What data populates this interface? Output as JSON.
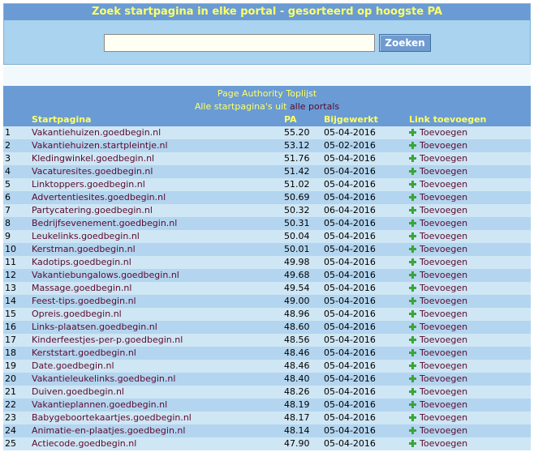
{
  "search": {
    "title": "Zoek startpagina in elke portal - gesorteerd op hoogste PA",
    "input_value": "",
    "placeholder": "",
    "button_label": "Zoeken"
  },
  "toplist": {
    "title": "Page Authority Toplijst",
    "subtitle_prefix": "Alle startpagina's uit ",
    "subtitle_link": "alle portals",
    "headers": {
      "rank": "",
      "name": "Startpagina",
      "pa": "PA",
      "date": "Bijgewerkt",
      "add": "Link toevoegen"
    },
    "rows": [
      {
        "rank": "1",
        "name": "Vakantiehuizen.goedbegin.nl",
        "pa": "55.20",
        "date": "05-04-2016",
        "add": "Toevoegen"
      },
      {
        "rank": "2",
        "name": "Vakantiehuizen.startpleintje.nl",
        "pa": "53.12",
        "date": "05-02-2016",
        "add": "Toevoegen"
      },
      {
        "rank": "3",
        "name": "Kledingwinkel.goedbegin.nl",
        "pa": "51.76",
        "date": "05-04-2016",
        "add": "Toevoegen"
      },
      {
        "rank": "4",
        "name": "Vacaturesites.goedbegin.nl",
        "pa": "51.42",
        "date": "05-04-2016",
        "add": "Toevoegen"
      },
      {
        "rank": "5",
        "name": "Linktoppers.goedbegin.nl",
        "pa": "51.02",
        "date": "05-04-2016",
        "add": "Toevoegen"
      },
      {
        "rank": "6",
        "name": "Advertentiesites.goedbegin.nl",
        "pa": "50.69",
        "date": "05-04-2016",
        "add": "Toevoegen"
      },
      {
        "rank": "7",
        "name": "Partycatering.goedbegin.nl",
        "pa": "50.32",
        "date": "06-04-2016",
        "add": "Toevoegen"
      },
      {
        "rank": "8",
        "name": "Bedrijfsevenement.goedbegin.nl",
        "pa": "50.31",
        "date": "05-04-2016",
        "add": "Toevoegen"
      },
      {
        "rank": "9",
        "name": "Leukelinks.goedbegin.nl",
        "pa": "50.04",
        "date": "05-04-2016",
        "add": "Toevoegen"
      },
      {
        "rank": "10",
        "name": "Kerstman.goedbegin.nl",
        "pa": "50.01",
        "date": "05-04-2016",
        "add": "Toevoegen"
      },
      {
        "rank": "11",
        "name": "Kadotips.goedbegin.nl",
        "pa": "49.98",
        "date": "05-04-2016",
        "add": "Toevoegen"
      },
      {
        "rank": "12",
        "name": "Vakantiebungalows.goedbegin.nl",
        "pa": "49.68",
        "date": "05-04-2016",
        "add": "Toevoegen"
      },
      {
        "rank": "13",
        "name": "Massage.goedbegin.nl",
        "pa": "49.54",
        "date": "05-04-2016",
        "add": "Toevoegen"
      },
      {
        "rank": "14",
        "name": "Feest-tips.goedbegin.nl",
        "pa": "49.00",
        "date": "05-04-2016",
        "add": "Toevoegen"
      },
      {
        "rank": "15",
        "name": "Opreis.goedbegin.nl",
        "pa": "48.96",
        "date": "05-04-2016",
        "add": "Toevoegen"
      },
      {
        "rank": "16",
        "name": "Links-plaatsen.goedbegin.nl",
        "pa": "48.60",
        "date": "05-04-2016",
        "add": "Toevoegen"
      },
      {
        "rank": "17",
        "name": "Kinderfeestjes-per-p.goedbegin.nl",
        "pa": "48.56",
        "date": "05-04-2016",
        "add": "Toevoegen"
      },
      {
        "rank": "18",
        "name": "Kerststart.goedbegin.nl",
        "pa": "48.46",
        "date": "05-04-2016",
        "add": "Toevoegen"
      },
      {
        "rank": "19",
        "name": "Date.goedbegin.nl",
        "pa": "48.46",
        "date": "05-04-2016",
        "add": "Toevoegen"
      },
      {
        "rank": "20",
        "name": "Vakantieleukelinks.goedbegin.nl",
        "pa": "48.40",
        "date": "05-04-2016",
        "add": "Toevoegen"
      },
      {
        "rank": "21",
        "name": "Duiven.goedbegin.nl",
        "pa": "48.26",
        "date": "05-04-2016",
        "add": "Toevoegen"
      },
      {
        "rank": "22",
        "name": "Vakantieplannen.goedbegin.nl",
        "pa": "48.19",
        "date": "05-04-2016",
        "add": "Toevoegen"
      },
      {
        "rank": "23",
        "name": "Babygeboortekaartjes.goedbegin.nl",
        "pa": "48.17",
        "date": "05-04-2016",
        "add": "Toevoegen"
      },
      {
        "rank": "24",
        "name": "Animatie-en-plaatjes.goedbegin.nl",
        "pa": "48.14",
        "date": "05-04-2016",
        "add": "Toevoegen"
      },
      {
        "rank": "25",
        "name": "Actiecode.goedbegin.nl",
        "pa": "47.90",
        "date": "05-04-2016",
        "add": "Toevoegen"
      }
    ]
  },
  "colors": {
    "header_bg": "#6a9bd4",
    "header_text": "#ffff66",
    "link": "#5a0a2e",
    "row_light": "#cfe6f4",
    "row_dark": "#b3d5ef",
    "add_icon": "#3aa53a"
  },
  "icons": {
    "add": "plus-icon"
  }
}
